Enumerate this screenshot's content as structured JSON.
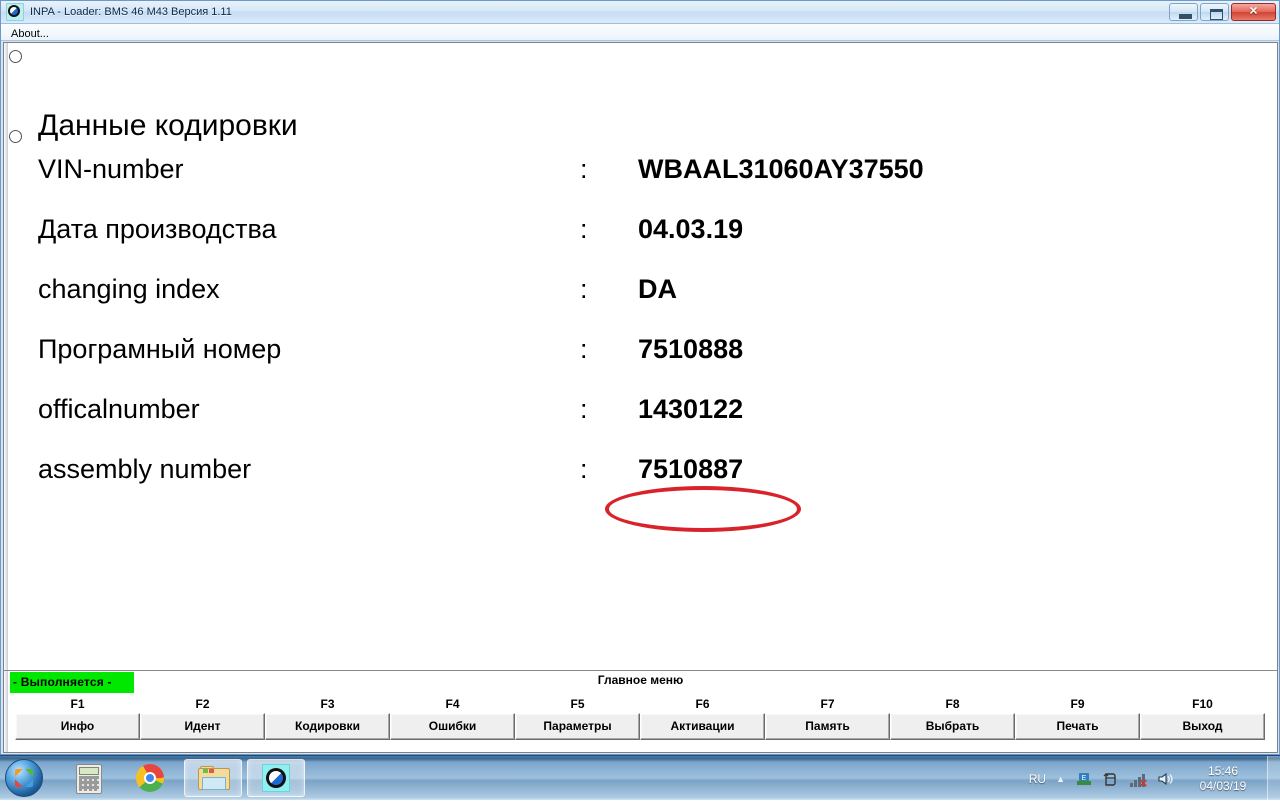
{
  "window": {
    "title": "INPA - Loader:  BMS 46 M43 Версия 1.11",
    "icon": "bmw-roundel-icon",
    "minimize_label": "",
    "maximize_label": "",
    "close_label": "✕"
  },
  "menubar": {
    "items": [
      {
        "label": "About..."
      }
    ]
  },
  "content": {
    "heading": "Данные кодировки",
    "separator": ":",
    "rows": [
      {
        "label": "VIN-number",
        "value": "WBAAL31060AY37550",
        "highlighted": false
      },
      {
        "label": "Дата производства",
        "value": "04.03.19",
        "highlighted": false
      },
      {
        "label": "changing index",
        "value": "DA",
        "highlighted": false
      },
      {
        "label": "Програмный номер",
        "value": "7510888",
        "highlighted": false
      },
      {
        "label": "officalnumber",
        "value": "1430122",
        "highlighted": false
      },
      {
        "label": "assembly number",
        "value": "7510887",
        "highlighted": true
      }
    ],
    "highlight_color": "#d9232b"
  },
  "bottom": {
    "status": "- Выполняется -",
    "status_color": "#00e800",
    "menu_title": "Главное меню",
    "fkeys": [
      {
        "key": "F1",
        "label": "Инфо"
      },
      {
        "key": "F2",
        "label": "Идент"
      },
      {
        "key": "F3",
        "label": "Кодировки"
      },
      {
        "key": "F4",
        "label": "Ошибки"
      },
      {
        "key": "F5",
        "label": "Параметры"
      },
      {
        "key": "F6",
        "label": "Активации"
      },
      {
        "key": "F7",
        "label": "Память"
      },
      {
        "key": "F8",
        "label": "Выбрать"
      },
      {
        "key": "F9",
        "label": "Печать"
      },
      {
        "key": "F10",
        "label": "Выход"
      }
    ]
  },
  "taskbar": {
    "start_label": "",
    "buttons": [
      {
        "name": "calculator",
        "active": false
      },
      {
        "name": "google-chrome",
        "active": false
      },
      {
        "name": "windows-explorer",
        "active": true
      },
      {
        "name": "inpa-bmw",
        "active": true
      }
    ],
    "tray": {
      "language": "RU",
      "chevron": "▲",
      "time": "15:46",
      "date": "04/03/19"
    }
  }
}
